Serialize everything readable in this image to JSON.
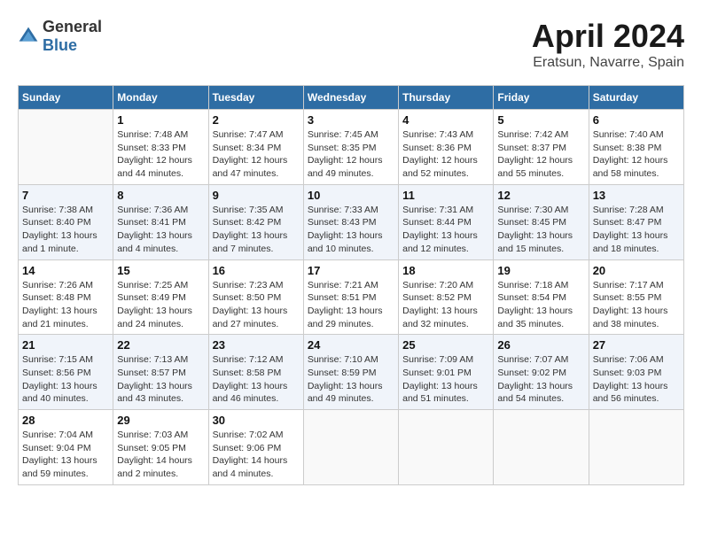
{
  "header": {
    "logo_general": "General",
    "logo_blue": "Blue",
    "month": "April 2024",
    "location": "Eratsun, Navarre, Spain"
  },
  "days_of_week": [
    "Sunday",
    "Monday",
    "Tuesday",
    "Wednesday",
    "Thursday",
    "Friday",
    "Saturday"
  ],
  "weeks": [
    [
      {
        "day": "",
        "sunrise": "",
        "sunset": "",
        "daylight": ""
      },
      {
        "day": "1",
        "sunrise": "Sunrise: 7:48 AM",
        "sunset": "Sunset: 8:33 PM",
        "daylight": "Daylight: 12 hours and 44 minutes."
      },
      {
        "day": "2",
        "sunrise": "Sunrise: 7:47 AM",
        "sunset": "Sunset: 8:34 PM",
        "daylight": "Daylight: 12 hours and 47 minutes."
      },
      {
        "day": "3",
        "sunrise": "Sunrise: 7:45 AM",
        "sunset": "Sunset: 8:35 PM",
        "daylight": "Daylight: 12 hours and 49 minutes."
      },
      {
        "day": "4",
        "sunrise": "Sunrise: 7:43 AM",
        "sunset": "Sunset: 8:36 PM",
        "daylight": "Daylight: 12 hours and 52 minutes."
      },
      {
        "day": "5",
        "sunrise": "Sunrise: 7:42 AM",
        "sunset": "Sunset: 8:37 PM",
        "daylight": "Daylight: 12 hours and 55 minutes."
      },
      {
        "day": "6",
        "sunrise": "Sunrise: 7:40 AM",
        "sunset": "Sunset: 8:38 PM",
        "daylight": "Daylight: 12 hours and 58 minutes."
      }
    ],
    [
      {
        "day": "7",
        "sunrise": "Sunrise: 7:38 AM",
        "sunset": "Sunset: 8:40 PM",
        "daylight": "Daylight: 13 hours and 1 minute."
      },
      {
        "day": "8",
        "sunrise": "Sunrise: 7:36 AM",
        "sunset": "Sunset: 8:41 PM",
        "daylight": "Daylight: 13 hours and 4 minutes."
      },
      {
        "day": "9",
        "sunrise": "Sunrise: 7:35 AM",
        "sunset": "Sunset: 8:42 PM",
        "daylight": "Daylight: 13 hours and 7 minutes."
      },
      {
        "day": "10",
        "sunrise": "Sunrise: 7:33 AM",
        "sunset": "Sunset: 8:43 PM",
        "daylight": "Daylight: 13 hours and 10 minutes."
      },
      {
        "day": "11",
        "sunrise": "Sunrise: 7:31 AM",
        "sunset": "Sunset: 8:44 PM",
        "daylight": "Daylight: 13 hours and 12 minutes."
      },
      {
        "day": "12",
        "sunrise": "Sunrise: 7:30 AM",
        "sunset": "Sunset: 8:45 PM",
        "daylight": "Daylight: 13 hours and 15 minutes."
      },
      {
        "day": "13",
        "sunrise": "Sunrise: 7:28 AM",
        "sunset": "Sunset: 8:47 PM",
        "daylight": "Daylight: 13 hours and 18 minutes."
      }
    ],
    [
      {
        "day": "14",
        "sunrise": "Sunrise: 7:26 AM",
        "sunset": "Sunset: 8:48 PM",
        "daylight": "Daylight: 13 hours and 21 minutes."
      },
      {
        "day": "15",
        "sunrise": "Sunrise: 7:25 AM",
        "sunset": "Sunset: 8:49 PM",
        "daylight": "Daylight: 13 hours and 24 minutes."
      },
      {
        "day": "16",
        "sunrise": "Sunrise: 7:23 AM",
        "sunset": "Sunset: 8:50 PM",
        "daylight": "Daylight: 13 hours and 27 minutes."
      },
      {
        "day": "17",
        "sunrise": "Sunrise: 7:21 AM",
        "sunset": "Sunset: 8:51 PM",
        "daylight": "Daylight: 13 hours and 29 minutes."
      },
      {
        "day": "18",
        "sunrise": "Sunrise: 7:20 AM",
        "sunset": "Sunset: 8:52 PM",
        "daylight": "Daylight: 13 hours and 32 minutes."
      },
      {
        "day": "19",
        "sunrise": "Sunrise: 7:18 AM",
        "sunset": "Sunset: 8:54 PM",
        "daylight": "Daylight: 13 hours and 35 minutes."
      },
      {
        "day": "20",
        "sunrise": "Sunrise: 7:17 AM",
        "sunset": "Sunset: 8:55 PM",
        "daylight": "Daylight: 13 hours and 38 minutes."
      }
    ],
    [
      {
        "day": "21",
        "sunrise": "Sunrise: 7:15 AM",
        "sunset": "Sunset: 8:56 PM",
        "daylight": "Daylight: 13 hours and 40 minutes."
      },
      {
        "day": "22",
        "sunrise": "Sunrise: 7:13 AM",
        "sunset": "Sunset: 8:57 PM",
        "daylight": "Daylight: 13 hours and 43 minutes."
      },
      {
        "day": "23",
        "sunrise": "Sunrise: 7:12 AM",
        "sunset": "Sunset: 8:58 PM",
        "daylight": "Daylight: 13 hours and 46 minutes."
      },
      {
        "day": "24",
        "sunrise": "Sunrise: 7:10 AM",
        "sunset": "Sunset: 8:59 PM",
        "daylight": "Daylight: 13 hours and 49 minutes."
      },
      {
        "day": "25",
        "sunrise": "Sunrise: 7:09 AM",
        "sunset": "Sunset: 9:01 PM",
        "daylight": "Daylight: 13 hours and 51 minutes."
      },
      {
        "day": "26",
        "sunrise": "Sunrise: 7:07 AM",
        "sunset": "Sunset: 9:02 PM",
        "daylight": "Daylight: 13 hours and 54 minutes."
      },
      {
        "day": "27",
        "sunrise": "Sunrise: 7:06 AM",
        "sunset": "Sunset: 9:03 PM",
        "daylight": "Daylight: 13 hours and 56 minutes."
      }
    ],
    [
      {
        "day": "28",
        "sunrise": "Sunrise: 7:04 AM",
        "sunset": "Sunset: 9:04 PM",
        "daylight": "Daylight: 13 hours and 59 minutes."
      },
      {
        "day": "29",
        "sunrise": "Sunrise: 7:03 AM",
        "sunset": "Sunset: 9:05 PM",
        "daylight": "Daylight: 14 hours and 2 minutes."
      },
      {
        "day": "30",
        "sunrise": "Sunrise: 7:02 AM",
        "sunset": "Sunset: 9:06 PM",
        "daylight": "Daylight: 14 hours and 4 minutes."
      },
      {
        "day": "",
        "sunrise": "",
        "sunset": "",
        "daylight": ""
      },
      {
        "day": "",
        "sunrise": "",
        "sunset": "",
        "daylight": ""
      },
      {
        "day": "",
        "sunrise": "",
        "sunset": "",
        "daylight": ""
      },
      {
        "day": "",
        "sunrise": "",
        "sunset": "",
        "daylight": ""
      }
    ]
  ]
}
